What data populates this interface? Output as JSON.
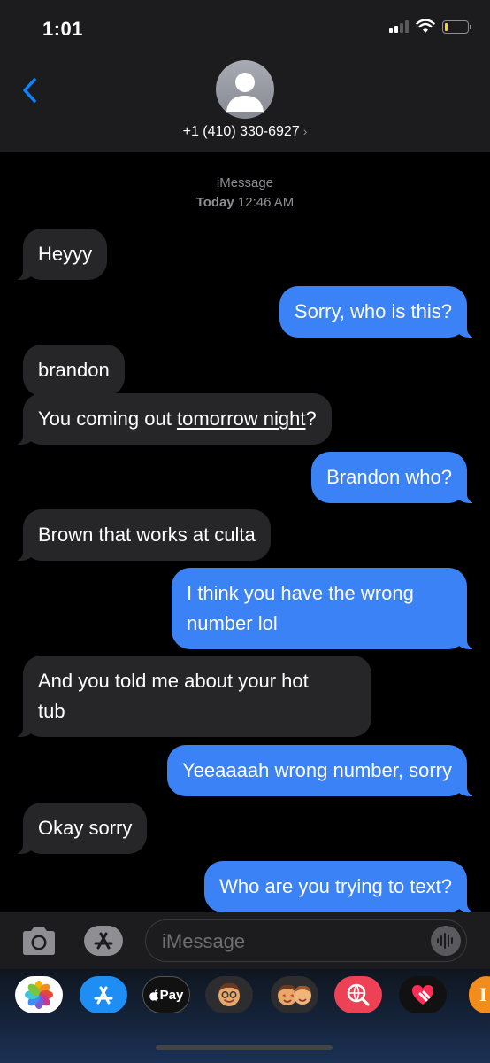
{
  "status_bar": {
    "time": "1:01"
  },
  "contact": {
    "phone": "+1 (410) 330-6927",
    "chevron": "›"
  },
  "thread_meta": {
    "service": "iMessage",
    "day": "Today",
    "time": "12:46 AM"
  },
  "messages": [
    {
      "dir": "in",
      "text": "Heyyy"
    },
    {
      "dir": "out",
      "text": "Sorry, who is this?"
    },
    {
      "dir": "in",
      "text": "brandon"
    },
    {
      "dir": "in",
      "text_before": "You coming out ",
      "text_link": "tomorrow night",
      "text_after": "?"
    },
    {
      "dir": "out",
      "text": "Brandon who?"
    },
    {
      "dir": "in",
      "text": "Brown that works at culta"
    },
    {
      "dir": "out",
      "line1": "I think you have the wrong",
      "line2": "number lol"
    },
    {
      "dir": "in",
      "line1": "And you told me about your hot",
      "line2": "tub"
    },
    {
      "dir": "out",
      "text": "Yeeaaaah wrong number, sorry"
    },
    {
      "dir": "in",
      "text": "Okay sorry"
    },
    {
      "dir": "out",
      "text": "Who are you trying to text?"
    }
  ],
  "input_bar": {
    "placeholder": "iMessage"
  },
  "app_drawer": {
    "apps": [
      {
        "icon": "photos-icon"
      },
      {
        "icon": "app-store-icon"
      },
      {
        "icon": "apple-pay-icon",
        "label": "Pay"
      },
      {
        "icon": "memoji-icon"
      },
      {
        "icon": "memoji-stickers-icon"
      },
      {
        "icon": "web-search-icon"
      },
      {
        "icon": "digital-touch-icon"
      },
      {
        "icon": "more-app-icon"
      }
    ]
  },
  "colors": {
    "outgoing_bubble": "#3b82f6",
    "incoming_bubble": "#262628",
    "header_bg": "#1c1c1e",
    "accent": "#0a84ff"
  }
}
